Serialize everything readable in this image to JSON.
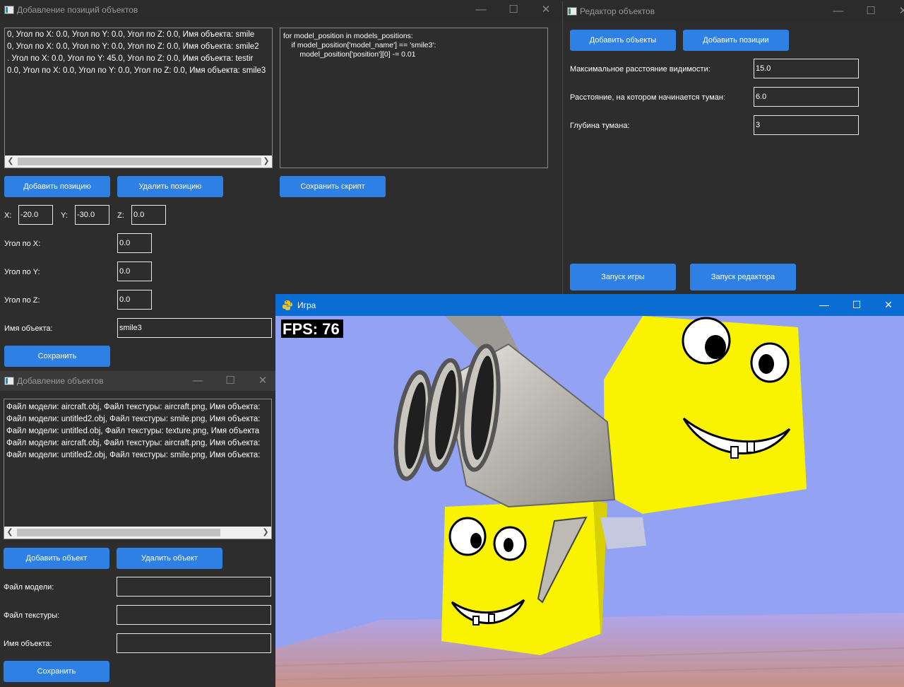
{
  "positions_window": {
    "title": "Добавление позиций объектов",
    "list_items": [
      "0, Угол по X: 0.0, Угол по Y: 0.0, Угол по Z: 0.0, Имя объекта: smile",
      "0, Угол по X: 0.0, Угол по Y: 0.0, Угол по Z: 0.0, Имя объекта: smile2",
      ". Угол по X: 0.0, Угол по Y: 45.0, Угол по Z: 0.0, Имя объекта: testir",
      "0.0, Угол по X: 0.0, Угол по Y: 0.0, Угол по Z: 0.0, Имя объекта: smile3"
    ],
    "script_lines": [
      "for model_position in models_positions:",
      "    if model_position['model_name'] == 'smile3':",
      "        model_position['position'][0] -= 0.01"
    ],
    "add_position_label": "Добавить позицию",
    "delete_position_label": "Удалить позицию",
    "save_script_label": "Сохранить скрипт",
    "x_label": "X:",
    "x_value": "-20.0",
    "y_label": "Y:",
    "y_value": "-30.0",
    "z_label": "Z:",
    "z_value": "0.0",
    "angle_x_label": "Угол по X:",
    "angle_x_value": "0.0",
    "angle_y_label": "Угол по Y:",
    "angle_y_value": "0.0",
    "angle_z_label": "Угол по Z:",
    "angle_z_value": "0.0",
    "name_label": "Имя объекта:",
    "name_value": "smile3",
    "save_label": "Сохранить"
  },
  "objects_window": {
    "title": "Добавление объектов",
    "list_items": [
      "Файл модели: aircraft.obj, Файл текстуры: aircraft.png, Имя объекта:",
      "Файл модели: untitled2.obj, Файл текстуры: smile.png, Имя объекта:",
      "Файл модели: untitled.obj, Файл текстуры: texture.png, Имя объекта",
      "Файл модели: aircraft.obj, Файл текстуры: aircraft.png, Имя объекта:",
      "Файл модели: untitled2.obj, Файл текстуры: smile.png, Имя объекта:"
    ],
    "add_object_label": "Добавить объект",
    "delete_object_label": "Удалить объект",
    "model_file_label": "Файл модели:",
    "texture_file_label": "Файл текстуры:",
    "name_label": "Имя объекта:",
    "save_label": "Сохранить"
  },
  "editor_window": {
    "title": "Редактор объектов",
    "add_objects_label": "Добавить объекты",
    "add_positions_label": "Добавить позиции",
    "max_distance_label": "Максимальное расстояние видимости:",
    "max_distance_value": "15.0",
    "fog_start_label": "Расстояние, на котором начинается туман:",
    "fog_start_value": "6.0",
    "fog_depth_label": "Глубина тумана:",
    "fog_depth_value": "3",
    "launch_game_label": "Запуск игры",
    "launch_editor_label": "Запуск редактора"
  },
  "game_window": {
    "title": "Игра",
    "fps": "FPS: 76"
  },
  "window_controls": {
    "minimize": "—",
    "maximize": "☐",
    "close": "✕"
  },
  "colors": {
    "button": "#2f80e4",
    "sky": "#93a2f2",
    "cube": "#f9f200",
    "game_titlebar": "#0a6dd4"
  }
}
